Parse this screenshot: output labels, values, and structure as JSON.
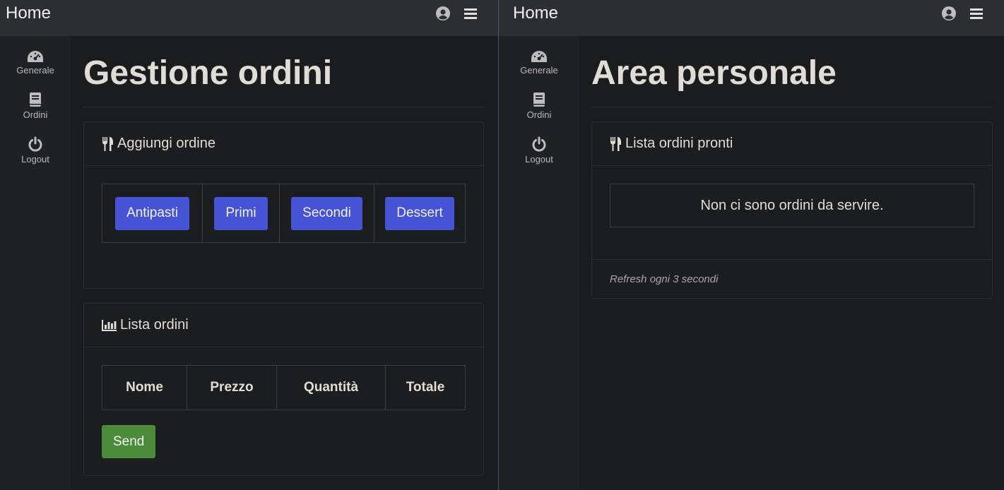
{
  "left": {
    "navbar": {
      "title": "Home"
    },
    "sidebar": {
      "items": [
        {
          "label": "Generale"
        },
        {
          "label": "Ordini"
        },
        {
          "label": "Logout"
        }
      ]
    },
    "page_title": "Gestione ordini",
    "add_card": {
      "title": "Aggiungi ordine",
      "categories": [
        "Antipasti",
        "Primi",
        "Secondi",
        "Dessert"
      ]
    },
    "list_card": {
      "title": "Lista ordini",
      "columns": [
        "Nome",
        "Prezzo",
        "Quantità",
        "Totale"
      ],
      "send_label": "Send"
    }
  },
  "right": {
    "navbar": {
      "title": "Home"
    },
    "sidebar": {
      "items": [
        {
          "label": "Generale"
        },
        {
          "label": "Ordini"
        },
        {
          "label": "Logout"
        }
      ]
    },
    "page_title": "Area personale",
    "ready_card": {
      "title": "Lista ordini pronti",
      "empty_message": "Non ci sono ordini da servire.",
      "footer": "Refresh ogni 3 secondi"
    }
  },
  "colors": {
    "primary_button": "#4553d4",
    "success_button": "#4b8b3b",
    "background": "#1b1c1e"
  },
  "icons": [
    "user-circle-icon",
    "hamburger-menu-icon",
    "speedometer-icon",
    "book-icon",
    "power-icon",
    "utensils-icon",
    "chart-bar-icon"
  ]
}
